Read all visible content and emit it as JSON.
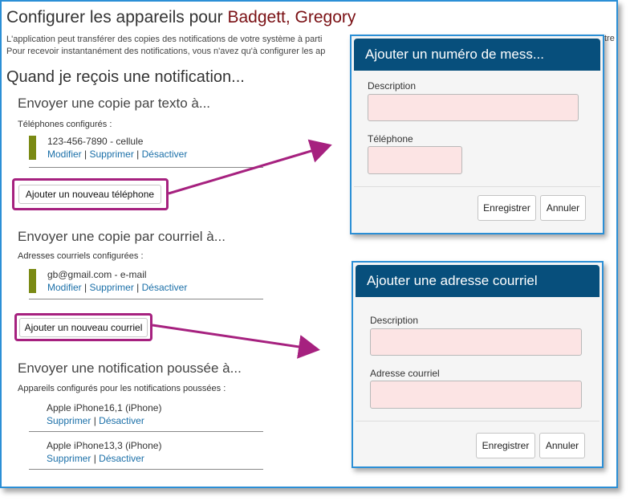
{
  "page": {
    "title_prefix": "Configurer les appareils pour ",
    "user_name": "Badgett, Gregory",
    "intro_line1": "L'application peut transférer des copies des notifications de votre système à parti",
    "intro_line1_tail": "tre",
    "intro_line2": "Pour recevoir instantanément des notifications, vous n'avez qu'à configurer les ap",
    "when_heading": "Quand je reçois une notification..."
  },
  "sms": {
    "heading": "Envoyer une copie par texto à...",
    "configured_label": "Téléphones configurés :",
    "devices": [
      {
        "name": "123-456-7890 - cellule",
        "edit": "Modifier",
        "delete": "Supprimer",
        "disable": "Désactiver"
      }
    ],
    "add_button": "Ajouter un nouveau téléphone"
  },
  "email": {
    "heading": "Envoyer une copie par courriel à...",
    "configured_label": "Adresses courriels configurées :",
    "devices": [
      {
        "name": "gb@gmail.com - e-mail",
        "edit": "Modifier",
        "delete": "Supprimer",
        "disable": "Désactiver"
      }
    ],
    "add_button": "Ajouter un nouveau courriel"
  },
  "push": {
    "heading": "Envoyer une notification poussée à...",
    "configured_label": "Appareils configurés pour les notifications poussées :",
    "devices": [
      {
        "name": "Apple iPhone16,1 (iPhone)",
        "delete": "Supprimer",
        "disable": "Désactiver"
      },
      {
        "name": "Apple iPhone13,3 (iPhone)",
        "delete": "Supprimer",
        "disable": "Désactiver"
      }
    ]
  },
  "phone_modal": {
    "title": "Ajouter un numéro de mess...",
    "description_label": "Description",
    "description_value": "",
    "phone_label": "Téléphone",
    "phone_value": "",
    "save": "Enregistrer",
    "cancel": "Annuler"
  },
  "email_modal": {
    "title": "Ajouter une adresse courriel",
    "description_label": "Description",
    "description_value": "",
    "email_label": "Adresse courriel",
    "email_value": "",
    "save": "Enregistrer",
    "cancel": "Annuler"
  },
  "colors": {
    "frame_border": "#2b8fd6",
    "modal_header": "#074f7c",
    "highlight": "#a6217f",
    "field_bg": "#fce4e4",
    "link": "#1a6fa8",
    "device_bar": "#7a8a14",
    "user_name": "#7a1014"
  }
}
